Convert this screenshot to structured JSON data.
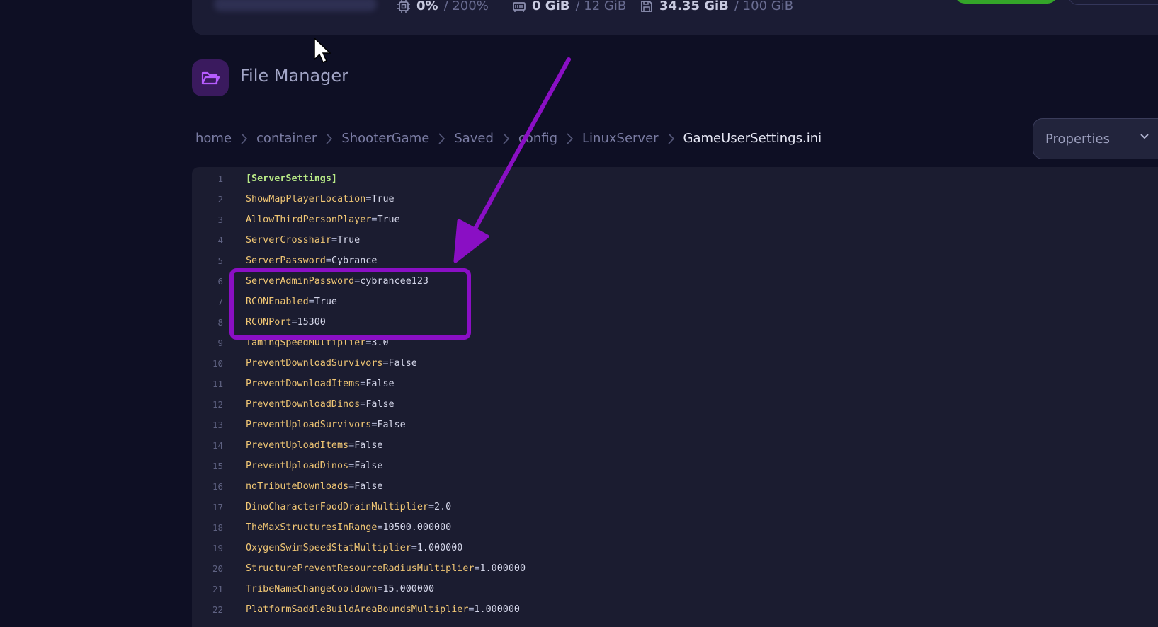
{
  "header": {
    "cpu": {
      "value": "0%",
      "max": "/ 200%",
      "icon": "cpu-icon"
    },
    "memory": {
      "value": "0 GiB",
      "max": "/ 12 GiB",
      "icon": "memory-icon"
    },
    "disk": {
      "value": "34.35 GiB",
      "max": "/ 100 GiB",
      "icon": "disk-icon"
    }
  },
  "file_manager": {
    "title": "File Manager",
    "icon": "folder-open-icon"
  },
  "breadcrumb": [
    "home",
    "container",
    "ShooterGame",
    "Saved",
    "config",
    "LinuxServer",
    "GameUserSettings.ini"
  ],
  "properties_button": "Properties",
  "editor": {
    "section_header": "[ServerSettings]",
    "lines": [
      {
        "no": "1",
        "key": "[ServerSettings]",
        "value": ""
      },
      {
        "no": "2",
        "key": "ShowMapPlayerLocation",
        "value": "True"
      },
      {
        "no": "3",
        "key": "AllowThirdPersonPlayer",
        "value": "True"
      },
      {
        "no": "4",
        "key": "ServerCrosshair",
        "value": "True"
      },
      {
        "no": "5",
        "key": "ServerPassword",
        "value": "Cybrance"
      },
      {
        "no": "6",
        "key": "ServerAdminPassword",
        "value": "cybrancee123"
      },
      {
        "no": "7",
        "key": "RCONEnabled",
        "value": "True"
      },
      {
        "no": "8",
        "key": "RCONPort",
        "value": "15300"
      },
      {
        "no": "9",
        "key": "TamingSpeedMultiplier",
        "value": "3.0"
      },
      {
        "no": "10",
        "key": "PreventDownloadSurvivors",
        "value": "False"
      },
      {
        "no": "11",
        "key": "PreventDownloadItems",
        "value": "False"
      },
      {
        "no": "12",
        "key": "PreventDownloadDinos",
        "value": "False"
      },
      {
        "no": "13",
        "key": "PreventUploadSurvivors",
        "value": "False"
      },
      {
        "no": "14",
        "key": "PreventUploadItems",
        "value": "False"
      },
      {
        "no": "15",
        "key": "PreventUploadDinos",
        "value": "False"
      },
      {
        "no": "16",
        "key": "noTributeDownloads",
        "value": "False"
      },
      {
        "no": "17",
        "key": "DinoCharacterFoodDrainMultiplier",
        "value": "2.0"
      },
      {
        "no": "18",
        "key": "TheMaxStructuresInRange",
        "value": "10500.000000"
      },
      {
        "no": "19",
        "key": "OxygenSwimSpeedStatMultiplier",
        "value": "1.000000"
      },
      {
        "no": "20",
        "key": "StructurePreventResourceRadiusMultiplier",
        "value": "1.000000"
      },
      {
        "no": "21",
        "key": "TribeNameChangeCooldown",
        "value": "15.000000"
      },
      {
        "no": "22",
        "key": "PlatformSaddleBuildAreaBoundsMultiplier",
        "value": "1.000000"
      }
    ]
  },
  "colors": {
    "background": "#0e0f24",
    "annotation": "#8a0fc4",
    "key": "#f0c674",
    "section": "#b8e986"
  }
}
